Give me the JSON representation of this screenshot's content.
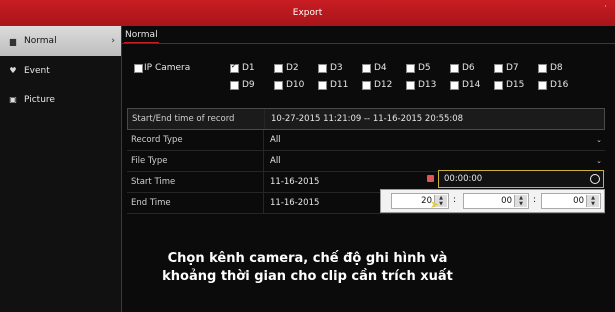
{
  "window": {
    "title": "Export"
  },
  "sidebar": {
    "items": [
      {
        "label": "Normal",
        "icon": "normal-icon",
        "active": true
      },
      {
        "label": "Event",
        "icon": "event-icon"
      },
      {
        "label": "Picture",
        "icon": "picture-icon"
      }
    ]
  },
  "tabs": [
    {
      "label": "Normal",
      "active": true
    }
  ],
  "channels": {
    "ip_camera_label": "IP Camera",
    "items": [
      "D1",
      "D2",
      "D3",
      "D4",
      "D5",
      "D6",
      "D7",
      "D8",
      "D9",
      "D10",
      "D11",
      "D12",
      "D13",
      "D14",
      "D15",
      "D16"
    ],
    "checked": [
      "D1"
    ]
  },
  "form": {
    "record_range": {
      "label": "Start/End time of record",
      "value": "10-27-2015 11:21:09 -- 11-16-2015 20:55:08"
    },
    "record_type": {
      "label": "Record Type",
      "value": "All"
    },
    "file_type": {
      "label": "File Type",
      "value": "All"
    },
    "start_time": {
      "label": "Start Time",
      "date": "11-16-2015",
      "time": "00:00:00"
    },
    "end_time": {
      "label": "End Time",
      "date": "11-16-2015"
    }
  },
  "time_picker": {
    "hour": "20",
    "minute": "00",
    "second": "00",
    "sep1": ":",
    "sep2": ":"
  },
  "subtitle": {
    "line1": "Chọn kênh camera, chế độ ghi hình và",
    "line2": "khoảng thời gian cho clip cần trích xuất"
  },
  "colors": {
    "accent": "#c81d22",
    "focus": "#c9b13a"
  }
}
